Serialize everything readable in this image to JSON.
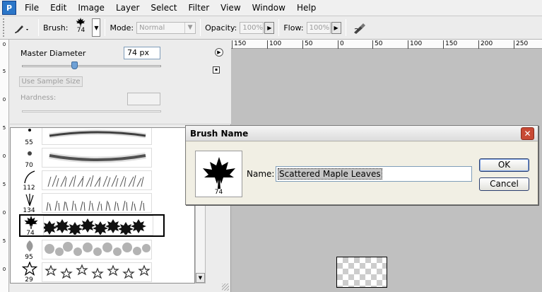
{
  "menu": [
    "File",
    "Edit",
    "Image",
    "Layer",
    "Select",
    "Filter",
    "View",
    "Window",
    "Help"
  ],
  "options": {
    "brush_label": "Brush:",
    "brush_size": "74",
    "mode_label": "Mode:",
    "mode_value": "Normal",
    "opacity_label": "Opacity:",
    "opacity_value": "100%",
    "flow_label": "Flow:",
    "flow_value": "100%"
  },
  "panel": {
    "master_diameter_label": "Master Diameter",
    "master_diameter_value": "74 px",
    "master_diameter_fraction": 0.37,
    "use_sample_size_label": "Use Sample Size",
    "hardness_label": "Hardness:",
    "brushes": [
      {
        "size": "55",
        "tip": "dot"
      },
      {
        "size": "70",
        "tip": "dot"
      },
      {
        "size": "112",
        "tip": "grass-blade"
      },
      {
        "size": "134",
        "tip": "grass-tuft"
      },
      {
        "size": "74",
        "tip": "maple-leaf",
        "selected": true
      },
      {
        "size": "95",
        "tip": "leaf"
      },
      {
        "size": "29",
        "tip": "star"
      }
    ],
    "left_ruler_labels": [
      "0",
      "5",
      "0",
      "5",
      "0",
      "5",
      "0",
      "5",
      "0"
    ]
  },
  "ruler": {
    "labels": [
      "150",
      "100",
      "50",
      "0",
      "50",
      "100",
      "150",
      "200",
      "250"
    ]
  },
  "dialog": {
    "title": "Brush Name",
    "name_label": "Name:",
    "name_value": "Scattered Maple Leaves",
    "preview_size": "74",
    "ok_label": "OK",
    "cancel_label": "Cancel"
  }
}
